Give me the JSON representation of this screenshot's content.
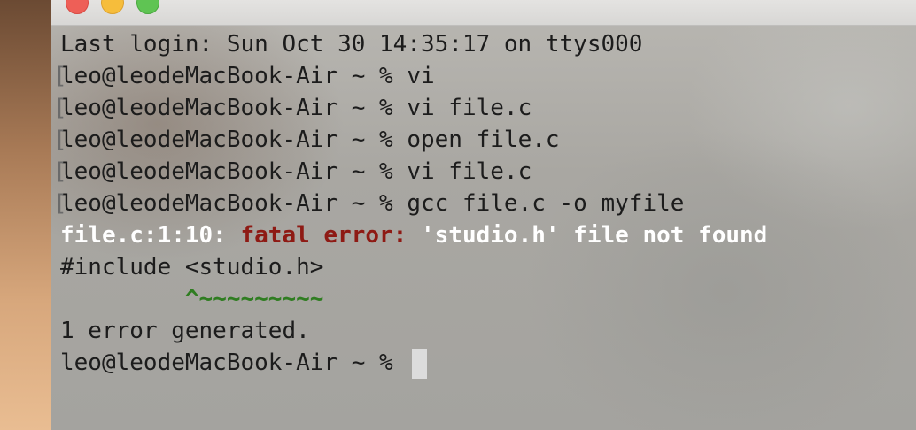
{
  "window": {
    "traffic_lights": [
      "close",
      "minimize",
      "zoom"
    ],
    "colors": {
      "close": "#ee5f57",
      "minimize": "#f6bd3b",
      "zoom": "#5fc453"
    }
  },
  "terminal": {
    "last_login": "Last login: Sun Oct 30 14:35:17 on ttys000",
    "prompt": "leo@leodeMacBook-Air ~ % ",
    "history_commands": [
      "vi",
      "vi file.c",
      "open file.c",
      "vi file.c",
      "gcc file.c -o myfile"
    ],
    "error": {
      "location": "file.c:1:10: ",
      "label": "fatal error: ",
      "message": "'studio.h' file not found",
      "source_line": "#include <studio.h>",
      "caret_indent": "         ",
      "caret": "^~~~~~~~~~"
    },
    "summary": "1 error generated.",
    "colors": {
      "text": "#1c1c1c",
      "error_white": "#ffffff",
      "error_red": "#8e1a14",
      "caret_green": "#2f7d21"
    }
  }
}
